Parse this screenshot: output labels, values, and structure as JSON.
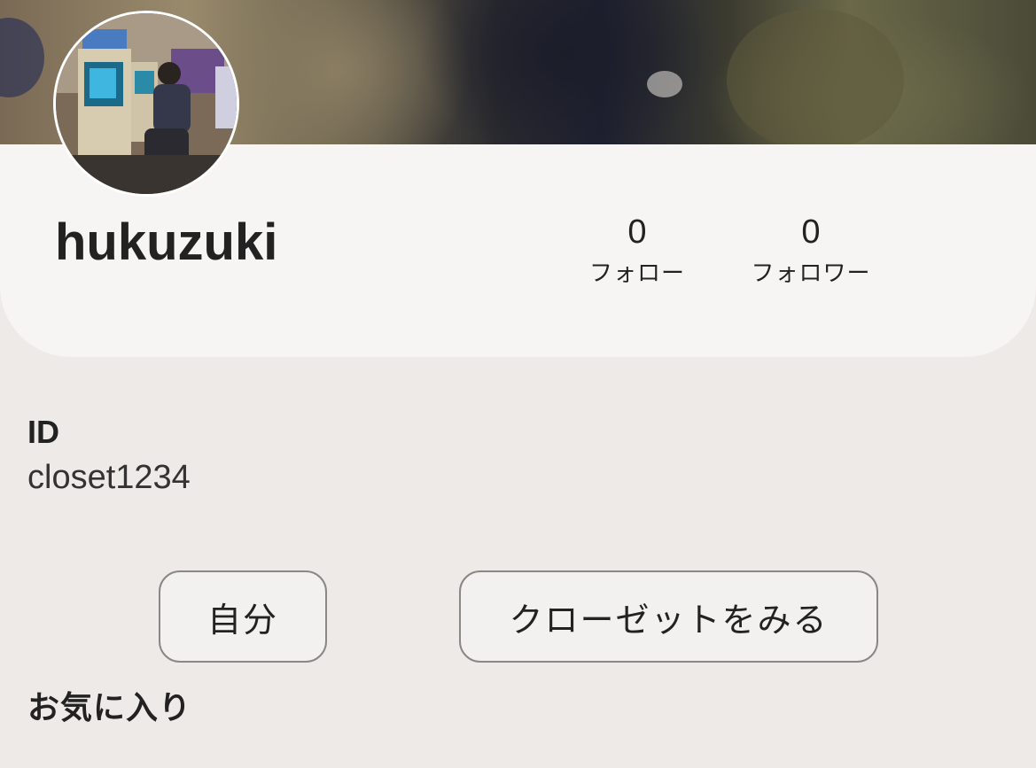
{
  "profile": {
    "username": "hukuzuki",
    "stats": {
      "follow_count": "0",
      "follow_label": "フォロー",
      "follower_count": "0",
      "follower_label": "フォロワー"
    }
  },
  "id_section": {
    "title": "ID",
    "value": "closet1234"
  },
  "actions": {
    "self_label": "自分",
    "closet_label": "クローゼットをみる"
  },
  "favorites": {
    "title": "お気に入り"
  },
  "colors": {
    "background": "#eeeae7",
    "card": "#f6f5f3",
    "text": "#222222",
    "button_border": "#8a8785"
  }
}
